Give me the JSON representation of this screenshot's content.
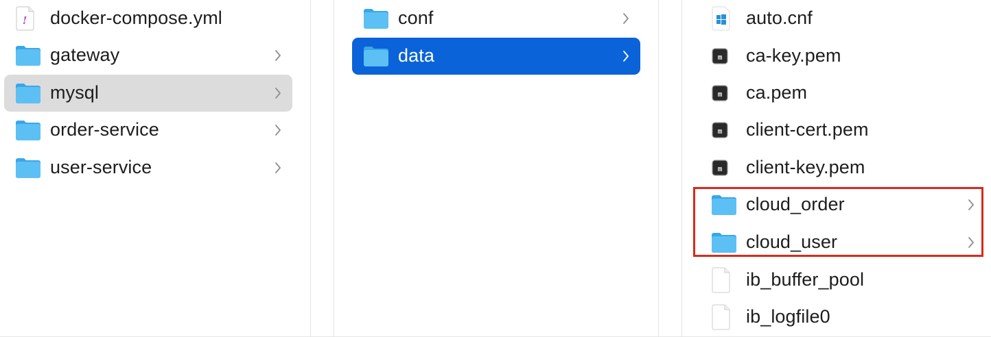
{
  "columns": [
    {
      "items": [
        {
          "label": "docker-compose.yml",
          "kind": "yaml-file",
          "icon": "yaml-file-icon",
          "has_children": false,
          "state": "normal"
        },
        {
          "label": "gateway",
          "kind": "folder",
          "icon": "folder-icon",
          "has_children": true,
          "state": "normal"
        },
        {
          "label": "mysql",
          "kind": "folder",
          "icon": "folder-icon",
          "has_children": true,
          "state": "selected-inactive"
        },
        {
          "label": "order-service",
          "kind": "folder",
          "icon": "folder-icon",
          "has_children": true,
          "state": "normal"
        },
        {
          "label": "user-service",
          "kind": "folder",
          "icon": "folder-icon",
          "has_children": true,
          "state": "normal"
        }
      ]
    },
    {
      "items": [
        {
          "label": "conf",
          "kind": "folder",
          "icon": "folder-icon",
          "has_children": true,
          "state": "normal"
        },
        {
          "label": "data",
          "kind": "folder",
          "icon": "folder-icon",
          "has_children": true,
          "state": "selected-active"
        }
      ]
    },
    {
      "items": [
        {
          "label": "auto.cnf",
          "kind": "cnf-file",
          "icon": "windows-file-icon",
          "has_children": false,
          "state": "normal"
        },
        {
          "label": "ca-key.pem",
          "kind": "pem-file",
          "icon": "terminal-exec-icon",
          "has_children": false,
          "state": "normal"
        },
        {
          "label": "ca.pem",
          "kind": "pem-file",
          "icon": "terminal-exec-icon",
          "has_children": false,
          "state": "normal"
        },
        {
          "label": "client-cert.pem",
          "kind": "pem-file",
          "icon": "terminal-exec-icon",
          "has_children": false,
          "state": "normal"
        },
        {
          "label": "client-key.pem",
          "kind": "pem-file",
          "icon": "terminal-exec-icon",
          "has_children": false,
          "state": "normal"
        },
        {
          "label": "cloud_order",
          "kind": "folder",
          "icon": "folder-icon",
          "has_children": true,
          "state": "normal"
        },
        {
          "label": "cloud_user",
          "kind": "folder",
          "icon": "folder-icon",
          "has_children": true,
          "state": "normal"
        },
        {
          "label": "ib_buffer_pool",
          "kind": "generic-file",
          "icon": "document-icon",
          "has_children": false,
          "state": "normal"
        },
        {
          "label": "ib_logfile0",
          "kind": "generic-file",
          "icon": "document-icon",
          "has_children": false,
          "state": "normal"
        }
      ]
    }
  ],
  "annotation": {
    "color": "#d9291c",
    "highlighted_items": [
      "cloud_order",
      "cloud_user"
    ]
  },
  "colors": {
    "selection_active": "#0a63d8",
    "selection_inactive": "#dcdcdc",
    "folder_blue": "#4fb6ef",
    "text": "#1d1d1f"
  }
}
